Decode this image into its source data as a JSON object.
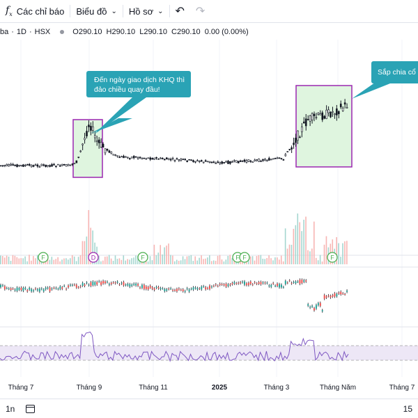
{
  "toolbar": {
    "indicators_label": "Các chỉ báo",
    "chart_type_label": "Biểu đồ",
    "profile_label": "Hồ sơ"
  },
  "legend": {
    "symbol_fragment": "ba",
    "interval": "1D",
    "exchange": "HSX",
    "separator": "·",
    "open": "O290.10",
    "high": "H290.10",
    "low": "L290.10",
    "close": "C290.10",
    "change": "0.00 (0.00%)"
  },
  "annotations": {
    "left_callout": [
      "Đến ngày giao dịch KHQ thì",
      "đảo chiều quay đầu!"
    ],
    "right_callout": "Sắp chia cổ"
  },
  "event_markers": [
    "F",
    "D",
    "F",
    "F",
    "F",
    "F"
  ],
  "bottombar": {
    "range_label": "1n",
    "time_fragment": "15"
  },
  "colors": {
    "up": "#26a69a",
    "down": "#ef5350",
    "callout": "#2aa3b5",
    "box_border": "#9c27b0",
    "box_fill": "#dff5df",
    "rsi_line": "#7e57c2",
    "rsi_band": "#ede7f6",
    "marker_green": "#4caf50",
    "marker_purple": "#9c27b0"
  },
  "chart_data": [
    {
      "type": "candlestick",
      "title": "",
      "x_tick_labels": [
        "Tháng 7",
        "Tháng 9",
        "Tháng 11",
        "2025",
        "Tháng 3",
        "Tháng Năm",
        "Tháng 7"
      ],
      "note": "price series estimated from shape; no price axis visible",
      "price_profile": [
        {
          "t": 0,
          "v": 238
        },
        {
          "t": 0.17,
          "v": 238
        },
        {
          "t": 0.19,
          "v": 232
        },
        {
          "t": 0.22,
          "v": 176
        },
        {
          "t": 0.24,
          "v": 206
        },
        {
          "t": 0.29,
          "v": 226
        },
        {
          "t": 0.33,
          "v": 226
        },
        {
          "t": 0.55,
          "v": 234
        },
        {
          "t": 0.7,
          "v": 228
        },
        {
          "t": 0.73,
          "v": 200
        },
        {
          "t": 0.76,
          "v": 172
        },
        {
          "t": 0.83,
          "v": 160
        },
        {
          "t": 0.86,
          "v": 150
        }
      ]
    },
    {
      "type": "bar",
      "title": "",
      "series": [
        {
          "values_note": "volume bars, mostly low with spikes near Tháng 9 and Tháng 3"
        }
      ]
    },
    {
      "type": "line",
      "title": "",
      "note": "oscillator below volume; drop near Tháng Năm"
    },
    {
      "type": "line",
      "title": "",
      "band": [
        30,
        70
      ],
      "note": "RSI-like oscillator with shaded band"
    }
  ]
}
